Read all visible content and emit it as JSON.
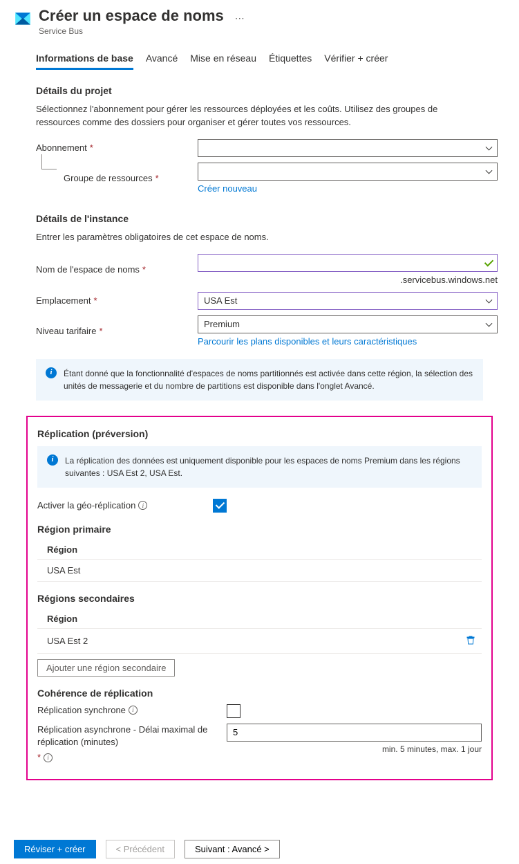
{
  "header": {
    "title": "Créer un espace de noms",
    "subtitle": "Service Bus"
  },
  "tabs": {
    "basics": "Informations de base",
    "advanced": "Avancé",
    "networking": "Mise en réseau",
    "tags": "Étiquettes",
    "review": "Vérifier + créer"
  },
  "project": {
    "title": "Détails du projet",
    "desc": "Sélectionnez l'abonnement pour gérer les ressources déployées et les coûts. Utilisez des groupes de ressources comme des dossiers pour organiser et gérer toutes vos ressources.",
    "subscription_label": "Abonnement",
    "resource_group_label": "Groupe de ressources",
    "create_new": "Créer nouveau"
  },
  "instance": {
    "title": "Détails de l'instance",
    "desc": "Entrer les paramètres obligatoires de cet espace de noms.",
    "namespace_label": "Nom de l'espace de noms",
    "suffix": ".servicebus.windows.net",
    "location_label": "Emplacement",
    "location_value": "USA Est",
    "tier_label": "Niveau tarifaire",
    "tier_value": "Premium",
    "browse_plans": "Parcourir les plans disponibles et leurs caractéristiques"
  },
  "info_partition": "Étant donné que la fonctionnalité d'espaces de noms partitionnés est activée dans cette région, la sélection des unités de messagerie et du nombre de partitions est disponible dans l'onglet Avancé.",
  "replication": {
    "title": "Réplication (préversion)",
    "info": "La réplication des données est uniquement disponible pour les espaces de noms Premium dans les régions suivantes : USA Est 2, USA Est.",
    "enable_label": "Activer la géo-réplication",
    "primary_title": "Région primaire",
    "region_col": "Région",
    "primary_value": "USA Est",
    "secondary_title": "Régions secondaires",
    "secondary_value": "USA Est 2",
    "add_btn": "Ajouter une région secondaire",
    "consistency_title": "Cohérence de réplication",
    "sync_label": "Réplication synchrone",
    "async_label": "Réplication asynchrone - Délai maximal de réplication (minutes)",
    "async_value": "5",
    "hint": "min. 5 minutes, max. 1 jour"
  },
  "footer": {
    "review": "Réviser + créer",
    "prev": "< Précédent",
    "next": "Suivant : Avancé >"
  }
}
